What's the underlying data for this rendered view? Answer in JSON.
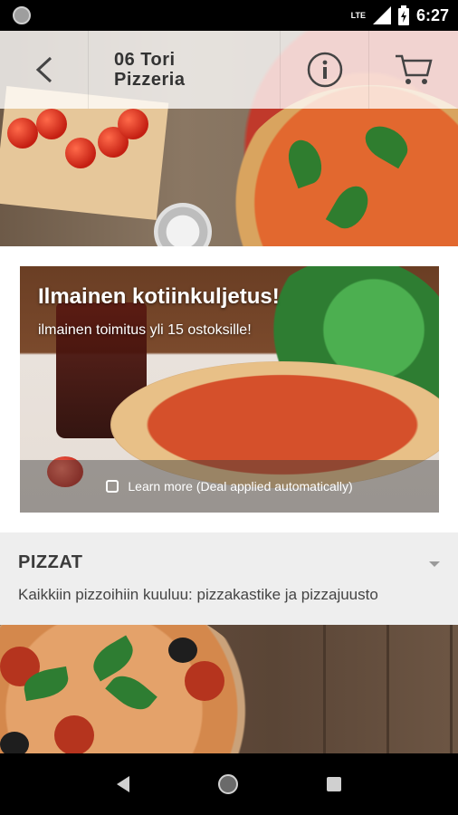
{
  "status_bar": {
    "time": "6:27",
    "network": "LTE",
    "icons": [
      "notification-dot-icon",
      "signal-icon",
      "battery-icon"
    ]
  },
  "toolbar": {
    "title": "06 Tori\nPizzeria",
    "back_icon": "back-arrow-icon",
    "info_icon": "info-icon",
    "cart_icon": "cart-icon"
  },
  "promo": {
    "title": "Ilmainen kotiinkuljetus!",
    "subtitle": "ilmainen toimitus yli 15 ostoksille!",
    "learn_more": "Learn more (Deal applied automatically)",
    "tag_icon": "tag-icon"
  },
  "category": {
    "title": "PIZZAT",
    "description": "Kaikkiin pizzoihiin kuuluu: pizzakastike ja pizzajuusto",
    "expand_icon": "dropdown-arrow-icon"
  },
  "navbar": {
    "icons": [
      "nav-back-icon",
      "nav-home-icon",
      "nav-recents-icon"
    ]
  },
  "colors": {
    "toolbar_overlay": "#ffffffc7",
    "category_bg": "#eeeeee",
    "text_dark": "#333333"
  }
}
